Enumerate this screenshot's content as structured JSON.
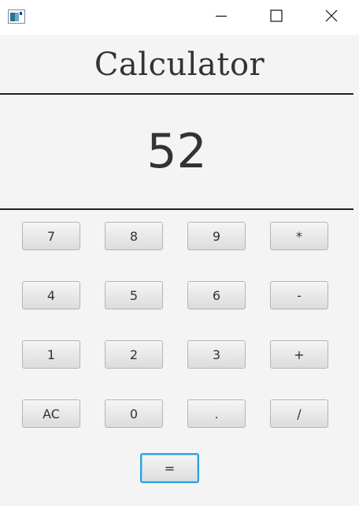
{
  "window": {
    "icon": "app-window-icon",
    "controls": [
      "minimize-icon",
      "maximize-icon",
      "close-icon"
    ]
  },
  "title": "Calculator",
  "display": {
    "value": "52"
  },
  "keypad": {
    "rows": [
      [
        "7",
        "8",
        "9",
        "*"
      ],
      [
        "4",
        "5",
        "6",
        "-"
      ],
      [
        "1",
        "2",
        "3",
        "+"
      ],
      [
        "AC",
        "0",
        ".",
        "/"
      ]
    ],
    "equals": "="
  },
  "colors": {
    "focus_border": "#2ba0d9",
    "background": "#f4f4f4",
    "rule": "#222222"
  }
}
